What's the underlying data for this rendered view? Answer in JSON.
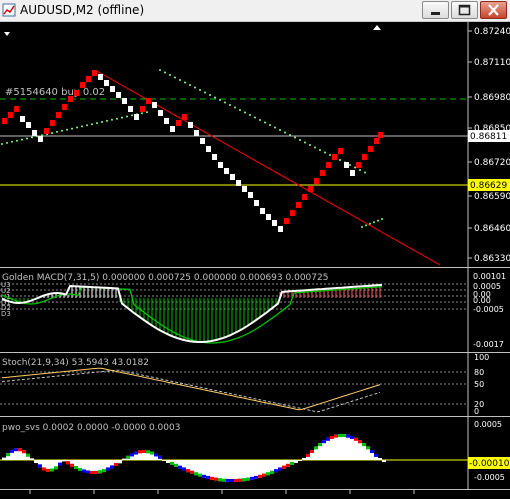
{
  "window": {
    "title": "AUDUSD,M2 (offline)"
  },
  "price_axis": {
    "labels": [
      "0.87240",
      "0.87110",
      "0.86980",
      "0.86850",
      "0.86720",
      "0.86590",
      "0.86460",
      "0.86330"
    ],
    "current_price": "0.86811",
    "yellow_level": "0.86629"
  },
  "main_chart": {
    "order_label": "#5154640 buy 0.02"
  },
  "macd": {
    "header": "Golden MACD(7,31,5) 0.000000 0.000725 0.000000 0.000693 0.000725",
    "axis_labels": [
      "0.00101",
      "0.0005",
      "0.00",
      "0.00",
      "-0.0005",
      "-0.0017"
    ],
    "level_labels": [
      "U3",
      "U2",
      "U1",
      "D1",
      "D2",
      "D3"
    ]
  },
  "stoch": {
    "header": "Stoch(21,9,34) 53.5943 43.0182",
    "axis_labels": [
      "100",
      "80",
      "50",
      "20",
      "0"
    ]
  },
  "pwo": {
    "header": "pwo_svs 0.0002 0.0000 -0.0000 0.0003",
    "axis_labels": [
      "0.0005",
      "0.0000",
      "-0.0005"
    ],
    "current_value": "-0.00010"
  },
  "colors": {
    "bull_brick": "#ff0000",
    "bear_brick": "#ffffff",
    "trendline": "#ff0000",
    "yellow_level": "#ffff00",
    "dotted_green": "#80ff80",
    "macd_line": "#ffffff",
    "macd_signal": "#00c000",
    "stoch_main": "#ffcc66",
    "stoch_signal": "#c0c0c0"
  }
}
